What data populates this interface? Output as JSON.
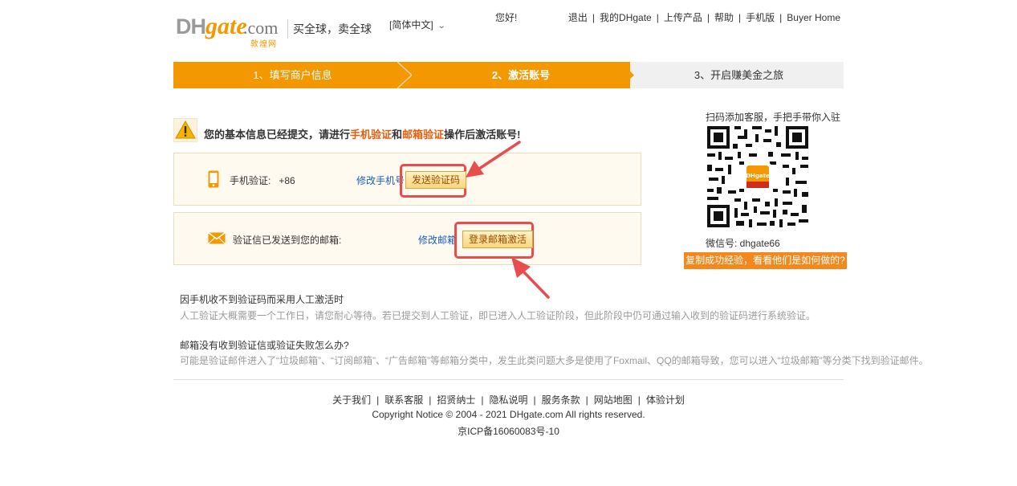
{
  "header": {
    "logo": {
      "part1": "DH",
      "part2": "gate",
      "part3": ".com",
      "sub": "敦煌网"
    },
    "slogan": "买全球，卖全球",
    "language": "[简体中文]",
    "greeting": "您好!",
    "nav": [
      "退出",
      "我的DHgate",
      "上传产品",
      "帮助",
      "手机版",
      "Buyer Home"
    ]
  },
  "steps": [
    {
      "label": "1、填写商户信息"
    },
    {
      "label": "2、激活账号"
    },
    {
      "label": "3、开启赚美金之旅"
    }
  ],
  "notice": {
    "prefix": "您的基本信息已经提交，请进行",
    "phone": "手机验证",
    "and": "和",
    "email": "邮箱验证",
    "suffix": "操作后激活账号!"
  },
  "phone_verify": {
    "label": "手机验证:   +86",
    "modify": "修改手机号",
    "button": "发送验证码"
  },
  "email_verify": {
    "label": "验证信已发送到您的邮箱:",
    "modify": "修改邮箱",
    "button": "登录邮箱激活"
  },
  "faq": [
    {
      "question": "因手机收不到验证码而采用人工激活时",
      "answer": "人工验证大概需要一个工作日，请您耐心等待。若已提交到人工验证，即已进入人工验证阶段，但此阶段中仍可通过输入收到的验证码进行系统验证。"
    },
    {
      "question": "邮箱没有收到验证信或验证失败怎么办?",
      "answer": "可能是验证邮件进入了“垃圾邮箱”、“订阅邮箱”、“广告邮箱”等邮箱分类中，发生此类问题大多是使用了Foxmail、QQ的邮箱导致，您可以进入“垃圾邮箱”等分类下找到验证邮件。"
    }
  ],
  "sidebar": {
    "qr_title": "扫码添加客服，手把手带你入驻",
    "qr_badge": "DHgate",
    "wechat": "微信号: dhgate66",
    "promo": "复制成功经验，看看他们是如何做的?"
  },
  "footer": {
    "links": [
      "关于我们",
      "联系客服",
      "招贤纳士",
      "隐私说明",
      "服务条款",
      "网站地图",
      "体验计划"
    ],
    "copyright": "Copyright Notice © 2004 - 2021 DHgate.com All rights reserved.",
    "icp": "京ICP备16060083号-10"
  },
  "colors": {
    "accent": "#f39800",
    "highlight": "#e85d0a",
    "link": "#1a5cb8",
    "annotation": "#e84c4c"
  }
}
